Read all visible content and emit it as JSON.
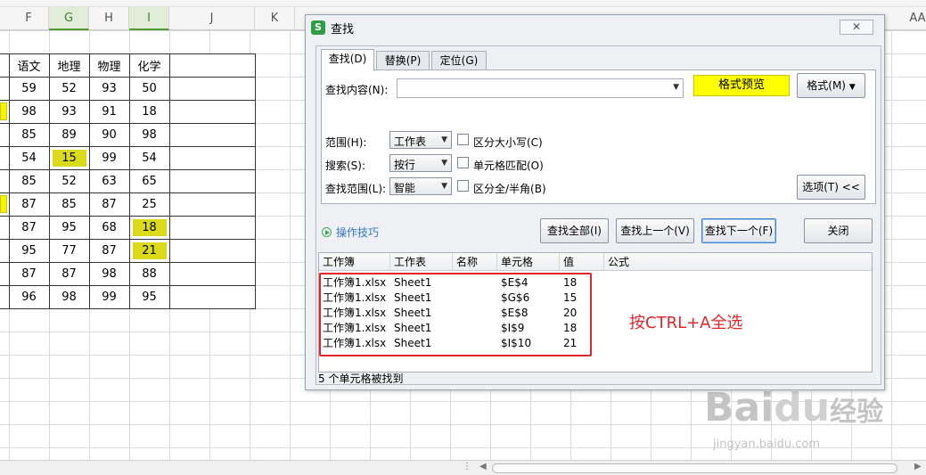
{
  "sheet": {
    "columns": [
      "F",
      "G",
      "H",
      "I",
      "J",
      "K",
      "AA"
    ],
    "selected_columns": [
      "G",
      "I"
    ],
    "table_header": [
      "语文",
      "地理",
      "物理",
      "化学"
    ],
    "rows": [
      [
        "59",
        "52",
        "93",
        "50"
      ],
      [
        "98",
        "93",
        "91",
        "18"
      ],
      [
        "85",
        "89",
        "90",
        "98"
      ],
      [
        "54",
        "15",
        "99",
        "54"
      ],
      [
        "85",
        "52",
        "63",
        "65"
      ],
      [
        "87",
        "85",
        "87",
        "25"
      ],
      [
        "87",
        "95",
        "68",
        "18"
      ],
      [
        "95",
        "77",
        "87",
        "21"
      ],
      [
        "87",
        "87",
        "98",
        "88"
      ],
      [
        "96",
        "98",
        "99",
        "95"
      ]
    ],
    "highlight_color": "#e2e21c"
  },
  "dialog": {
    "title": "查找",
    "close_label": "✕",
    "tabs": [
      {
        "label": "查找(D)",
        "active": true
      },
      {
        "label": "替换(P)",
        "active": false
      },
      {
        "label": "定位(G)",
        "active": false
      }
    ],
    "find_label": "查找内容(N):",
    "find_value": "",
    "format_preview": "格式预览",
    "format_button": "格式(M)",
    "scope_label": "范围(H):",
    "scope_value": "工作表",
    "search_label": "搜索(S):",
    "search_value": "按行",
    "lookin_label": "查找范围(L):",
    "lookin_value": "智能",
    "match_case": "区分大小写(C)",
    "match_cell": "单元格匹配(O)",
    "match_width": "区分全/半角(B)",
    "options_button": "选项(T) <<",
    "tips_link": "操作技巧",
    "find_all": "查找全部(I)",
    "find_prev": "查找上一个(V)",
    "find_next": "查找下一个(F)",
    "close_button": "关闭",
    "results_headers": [
      "工作簿",
      "工作表",
      "名称",
      "单元格",
      "值",
      "公式"
    ],
    "results": [
      {
        "book": "工作簿1.xlsx",
        "sheet": "Sheet1",
        "cell": "$E$4",
        "value": "18"
      },
      {
        "book": "工作簿1.xlsx",
        "sheet": "Sheet1",
        "cell": "$G$6",
        "value": "15"
      },
      {
        "book": "工作簿1.xlsx",
        "sheet": "Sheet1",
        "cell": "$E$8",
        "value": "20"
      },
      {
        "book": "工作簿1.xlsx",
        "sheet": "Sheet1",
        "cell": "$I$9",
        "value": "18"
      },
      {
        "book": "工作簿1.xlsx",
        "sheet": "Sheet1",
        "cell": "$I$10",
        "value": "21"
      }
    ],
    "annotation": "按CTRL+A全选",
    "status": "5 个单元格被找到",
    "annotation_color": "#e0262a",
    "accent": "#3d7fd1"
  },
  "watermark": {
    "main": "Bai",
    "paw": "du",
    "suffix": "经验",
    "url": "jingyan.baidu.com"
  }
}
